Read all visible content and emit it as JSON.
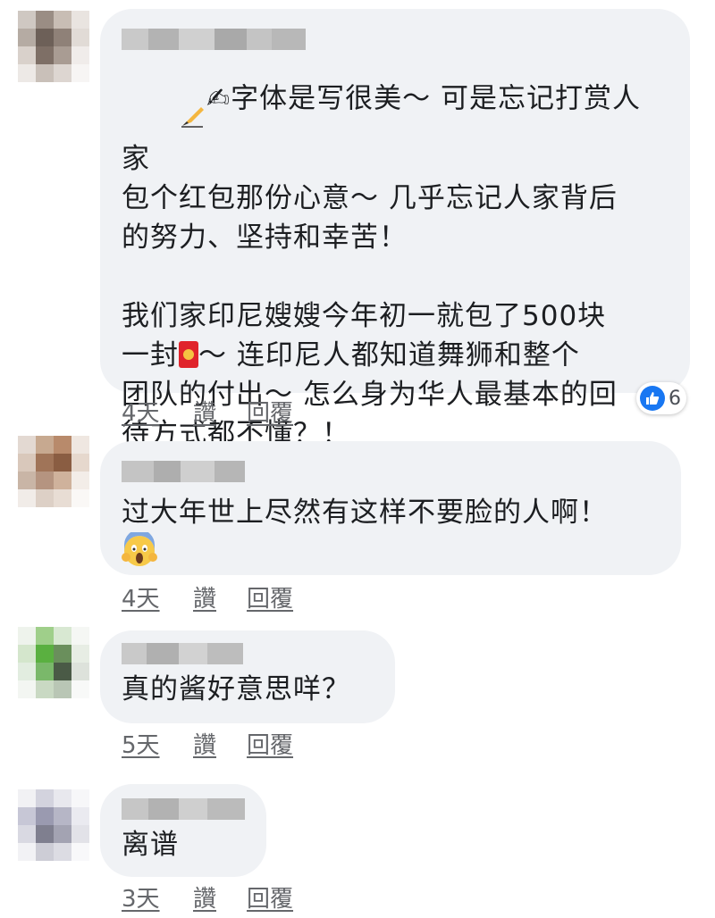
{
  "comments": [
    {
      "text_lines": [
        "✍字体是写很美～ 可是忘记打赏人家",
        "包个红包那份心意～ 几乎忘记人家背后",
        "的努力、坚持和幸苦！",
        "",
        "我们家印尼嫂嫂今年初一就包了500块",
        "一封",
        "～ 连印尼人都知道舞狮和整个",
        "团队的付出～ 怎么身为华人最基本的回",
        "待方式都不懂？！"
      ],
      "time": "4天",
      "like_label": "讚",
      "reply_label": "回覆",
      "reaction_count": "6",
      "reaction_icon": "like-icon",
      "inline_icons": [
        "writing-hand-icon",
        "red-envelope-icon"
      ]
    },
    {
      "text_lines": [
        "过大年世上尽然有这样不要脸的人啊！"
      ],
      "time": "4天",
      "like_label": "讚",
      "reply_label": "回覆",
      "inline_icons": [
        "screaming-face-icon"
      ]
    },
    {
      "text_lines": [
        "真的酱好意思咩？"
      ],
      "time": "5天",
      "like_label": "讚",
      "reply_label": "回覆"
    },
    {
      "text_lines": [
        "离谱"
      ],
      "time": "3天",
      "like_label": "讚",
      "reply_label": "回覆"
    }
  ],
  "colors": {
    "bubble": "#f0f2f5",
    "meta_text": "#65676b",
    "like_blue": "#1877f2"
  }
}
